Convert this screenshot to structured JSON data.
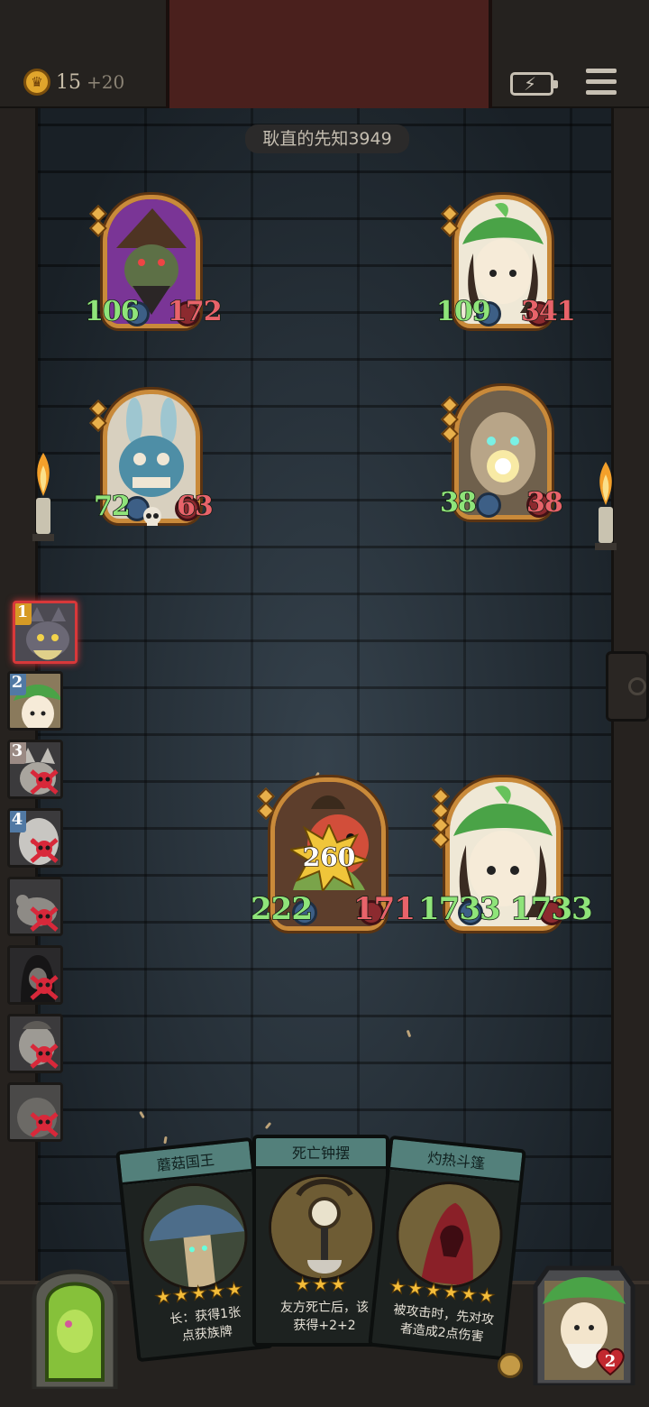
{
  "hud": {
    "coins": "15",
    "coin_bonus": "+20",
    "opponent_name": "耿直的先知3949"
  },
  "colors": {
    "attack": "#8fe47a",
    "damaged_health": "#e8636a",
    "frame_gold": "#c98a3a",
    "active_turn": "#d8383a",
    "card_header": "#53807b"
  },
  "enemy_board": [
    {
      "name": "mushroom-wizard-minion",
      "attack": "106",
      "health": "172",
      "health_damaged": true,
      "tier": 2
    },
    {
      "name": "leaf-girl-minion",
      "attack": "109",
      "health": "341",
      "health_damaged": true,
      "tier": 2
    },
    {
      "name": "rabbit-robot-minion",
      "attack": "72",
      "health": "63",
      "health_damaged": true,
      "tier": 2,
      "has_deathrattle_icon": true
    },
    {
      "name": "tree-golem-minion",
      "attack": "38",
      "health": "38",
      "health_damaged": true,
      "tier": 3
    }
  ],
  "player_board": [
    {
      "name": "flower-bird-minion",
      "attack": "222",
      "health": "171",
      "health_damaged": true,
      "tier": 2,
      "damage_taken": "260"
    },
    {
      "name": "leaf-girl-minion",
      "attack": "1733",
      "health": "1733",
      "health_damaged": false,
      "tier": 4
    }
  ],
  "turn_order": [
    {
      "position": "1",
      "portrait": "cat-portrait",
      "active": true,
      "eliminated": false
    },
    {
      "position": "2",
      "portrait": "leaf-girl-portrait",
      "active": false,
      "eliminated": false
    },
    {
      "position": "3",
      "portrait": "wolf-portrait",
      "active": false,
      "eliminated": true
    },
    {
      "position": "4",
      "portrait": "ghost-girl-portrait",
      "active": false,
      "eliminated": true
    },
    {
      "position": "",
      "portrait": "rat-portrait",
      "active": false,
      "eliminated": true
    },
    {
      "position": "",
      "portrait": "hooded-portrait",
      "active": false,
      "eliminated": true
    },
    {
      "position": "",
      "portrait": "zombie-portrait",
      "active": false,
      "eliminated": true
    },
    {
      "position": "",
      "portrait": "shadow-portrait",
      "active": false,
      "eliminated": true
    }
  ],
  "hand": [
    {
      "title": "蘑菇国王",
      "stars": "★★★★★",
      "desc_lines": [
        "长：获得1张",
        "点获族牌"
      ]
    },
    {
      "title": "死亡钟摆",
      "stars": "★★★",
      "desc_lines": [
        "友方死亡后，该",
        "获得+2+2"
      ]
    },
    {
      "title": "灼热斗篷",
      "stars": "★★★★★★",
      "desc_lines": [
        "被攻击时，先对攻",
        "者造成2点伤害"
      ]
    }
  ],
  "hero": {
    "health": "2"
  },
  "icons": [
    "crown-coin-icon",
    "battery-icon",
    "menu-icon",
    "skull-icon",
    "torch-icon",
    "shop-door-icon",
    "heart-icon",
    "armor-icon"
  ]
}
